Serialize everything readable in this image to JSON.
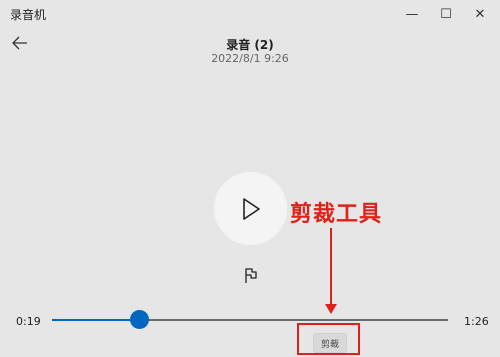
{
  "window": {
    "title": "录音机",
    "minimize_glyph": "—",
    "maximize_glyph": "☐",
    "close_glyph": "✕"
  },
  "recording": {
    "name": "录音 (2)",
    "date": "2022/8/1 9:26"
  },
  "playback": {
    "current_time": "0:19",
    "total_time": "1:26",
    "progress_fraction": 0.22
  },
  "trim_button": {
    "label": "剪裁"
  },
  "annotation": {
    "label": "剪裁工具",
    "color": "#e0201a"
  },
  "colors": {
    "accent": "#0067c0",
    "background": "#e6e6e6",
    "annotation": "#e0201a"
  },
  "icons": {
    "back": "arrow-left-icon",
    "play": "play-icon",
    "flag": "flag-icon"
  }
}
